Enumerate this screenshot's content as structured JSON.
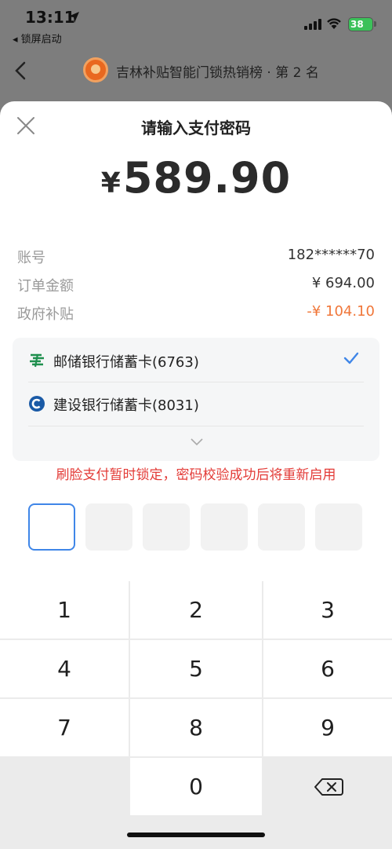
{
  "status": {
    "time": "13:11",
    "back_app": "◂ 锁屏启动",
    "battery": "38"
  },
  "background": {
    "title": "吉林补贴智能门锁热销榜 · 第 2 名"
  },
  "sheet": {
    "title": "请输入支付密码",
    "currency": "¥",
    "amount": "589.90",
    "info": {
      "account_label": "账号",
      "account_value": "182******70",
      "order_label": "订单金额",
      "order_value": "¥ 694.00",
      "subsidy_label": "政府补贴",
      "subsidy_value": "-¥ 104.10"
    },
    "banks": [
      {
        "name": "邮储银行储蓄卡(6763)",
        "icon": "psbc-logo-icon",
        "selected": true
      },
      {
        "name": "建设银行储蓄卡(8031)",
        "icon": "ccb-logo-icon",
        "selected": false
      }
    ],
    "warning": "刷脸支付暂时锁定，密码校验成功后将重新启用",
    "pin_length": 6
  },
  "keypad": {
    "keys": [
      "1",
      "2",
      "3",
      "4",
      "5",
      "6",
      "7",
      "8",
      "9",
      "0"
    ],
    "delete_icon": "backspace-icon"
  },
  "colors": {
    "accent": "#3f86e8",
    "warning": "#e33b37",
    "subsidy": "#f0773a",
    "psbc_green": "#1e8f4e",
    "ccb_blue": "#1a5aa6"
  }
}
